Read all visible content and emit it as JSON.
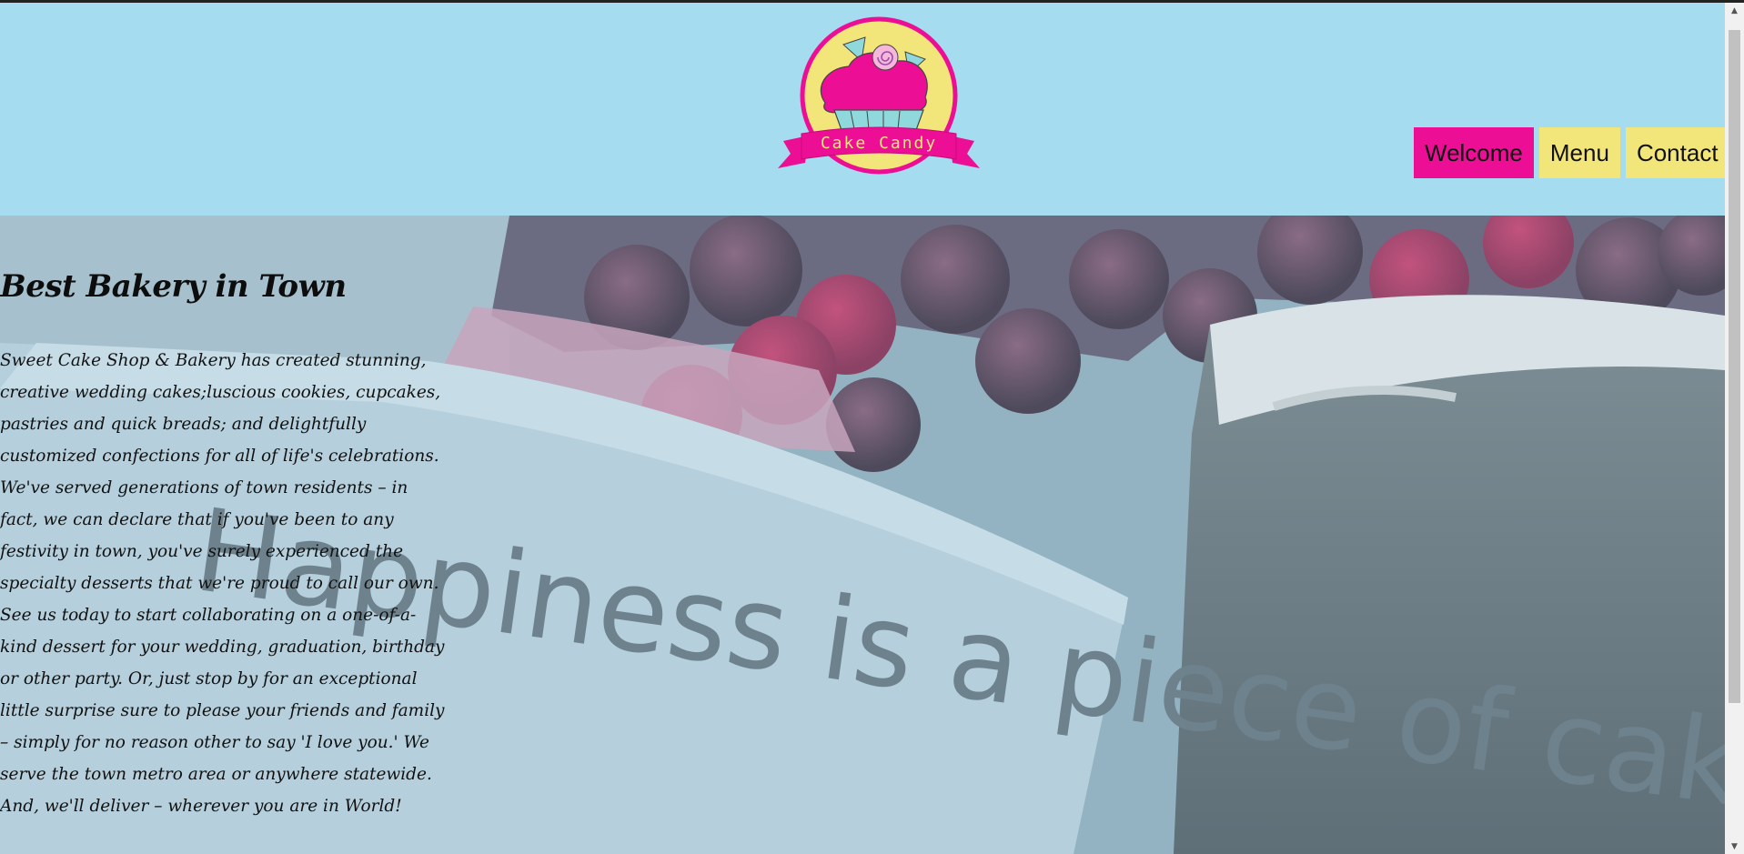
{
  "brand": {
    "logo_text": "Cake Candy"
  },
  "nav": {
    "items": [
      {
        "label": "Welcome",
        "active": true
      },
      {
        "label": "Menu",
        "active": false
      },
      {
        "label": "Contact",
        "active": false
      }
    ]
  },
  "hero": {
    "background_text": "Happiness is a piece of cake",
    "title": "Best Bakery in Town",
    "text": "Sweet Cake Shop & Bakery has created stunning, creative wedding cakes;luscious cookies, cupcakes, pastries and quick breads; and delightfully customized confections for all of life's celebrations. We've served generations of town residents – in fact, we can declare that if you've been to any festivity in town, you've surely experienced the specialty desserts that we're proud to call our own. See us today to start collaborating on a one-of-a-kind dessert for your wedding, graduation, birthday or other party. Or, just stop by for an exceptional little surprise sure to please your friends and family – simply for no reason other to say 'I love you.' We serve the town metro area or anywhere statewide. And, we'll deliver – wherever you are in World!"
  },
  "colors": {
    "header_bg": "#a5dcef",
    "accent_pink": "#ec0f95",
    "accent_yellow": "#f2e67a"
  }
}
